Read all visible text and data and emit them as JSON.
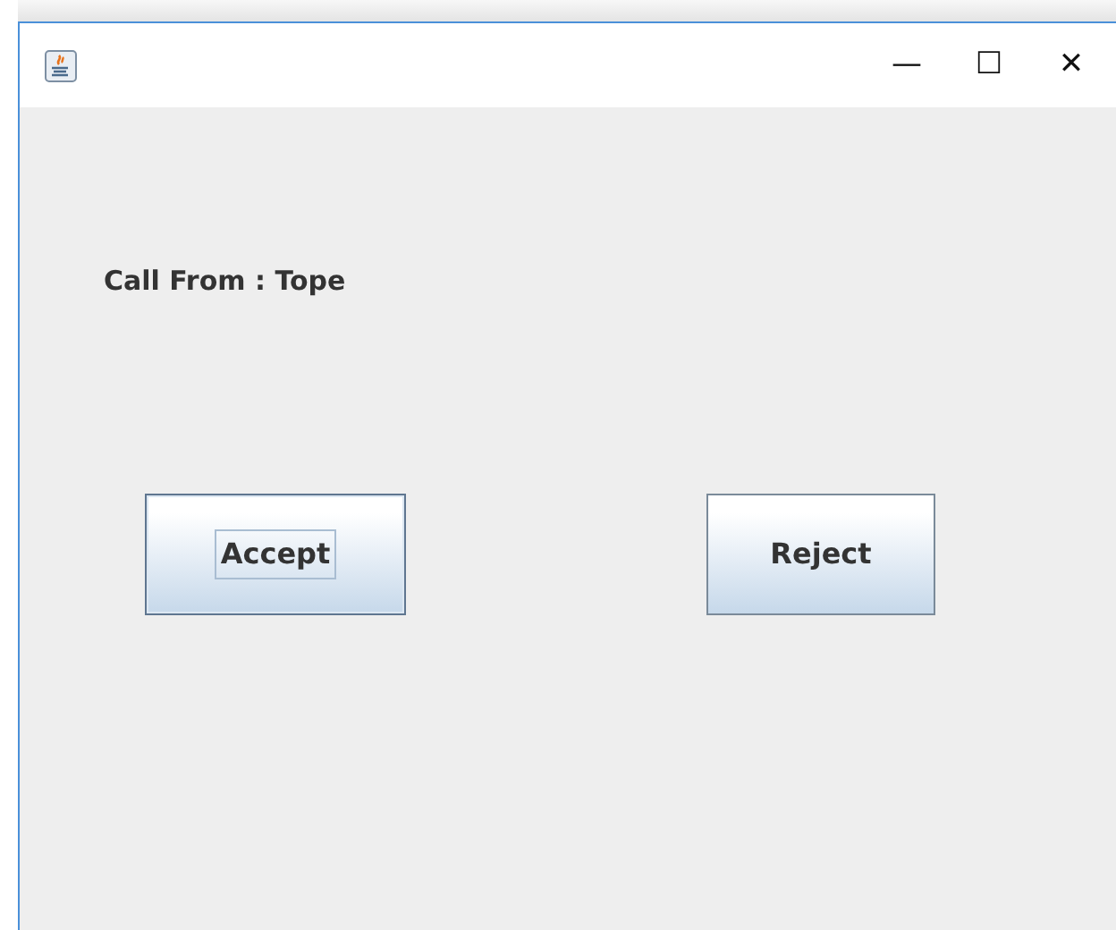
{
  "window": {
    "title_buttons": [
      "—",
      "☐",
      "✕"
    ]
  },
  "label": "Call From : Tope",
  "buttons": [
    {
      "label": "Accept",
      "focused": true
    },
    {
      "label": "Reject",
      "focused": false
    }
  ]
}
